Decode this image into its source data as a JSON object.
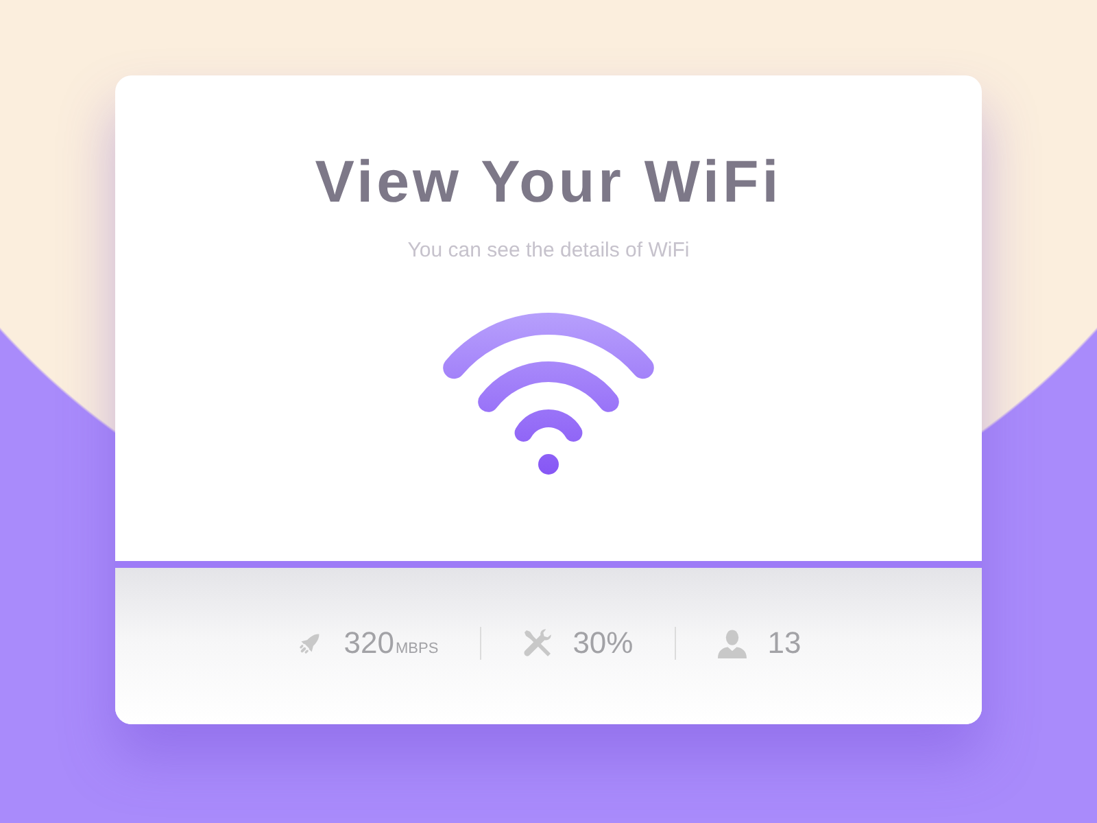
{
  "card": {
    "title": "View Your WiFi",
    "subtitle": "You can see the details of WiFi"
  },
  "stats": [
    {
      "kind": "speed",
      "value": "320",
      "unit": "MBPS"
    },
    {
      "kind": "usage",
      "value": "30%"
    },
    {
      "kind": "users",
      "value": "13"
    }
  ]
}
